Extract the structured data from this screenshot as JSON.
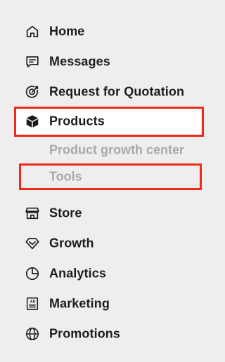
{
  "sidebar": {
    "items": [
      {
        "label": "Home",
        "icon": "home-icon"
      },
      {
        "label": "Messages",
        "icon": "message-icon"
      },
      {
        "label": "Request for Quotation",
        "icon": "target-icon"
      },
      {
        "label": "Products",
        "icon": "box-icon",
        "active": true
      },
      {
        "label": "Store",
        "icon": "store-icon"
      },
      {
        "label": "Growth",
        "icon": "diamond-icon"
      },
      {
        "label": "Analytics",
        "icon": "pie-chart-icon"
      },
      {
        "label": "Marketing",
        "icon": "ad-icon"
      },
      {
        "label": "Promotions",
        "icon": "globe-icon"
      }
    ],
    "products_subitems": [
      {
        "label": "Product growth center"
      },
      {
        "label": "Tools"
      }
    ]
  },
  "colors": {
    "background": "#efeeef",
    "text": "#1c1c1e",
    "subtext": "#a8a7aa",
    "highlight": "#ee2a1a",
    "active_bg": "#ffffff"
  }
}
